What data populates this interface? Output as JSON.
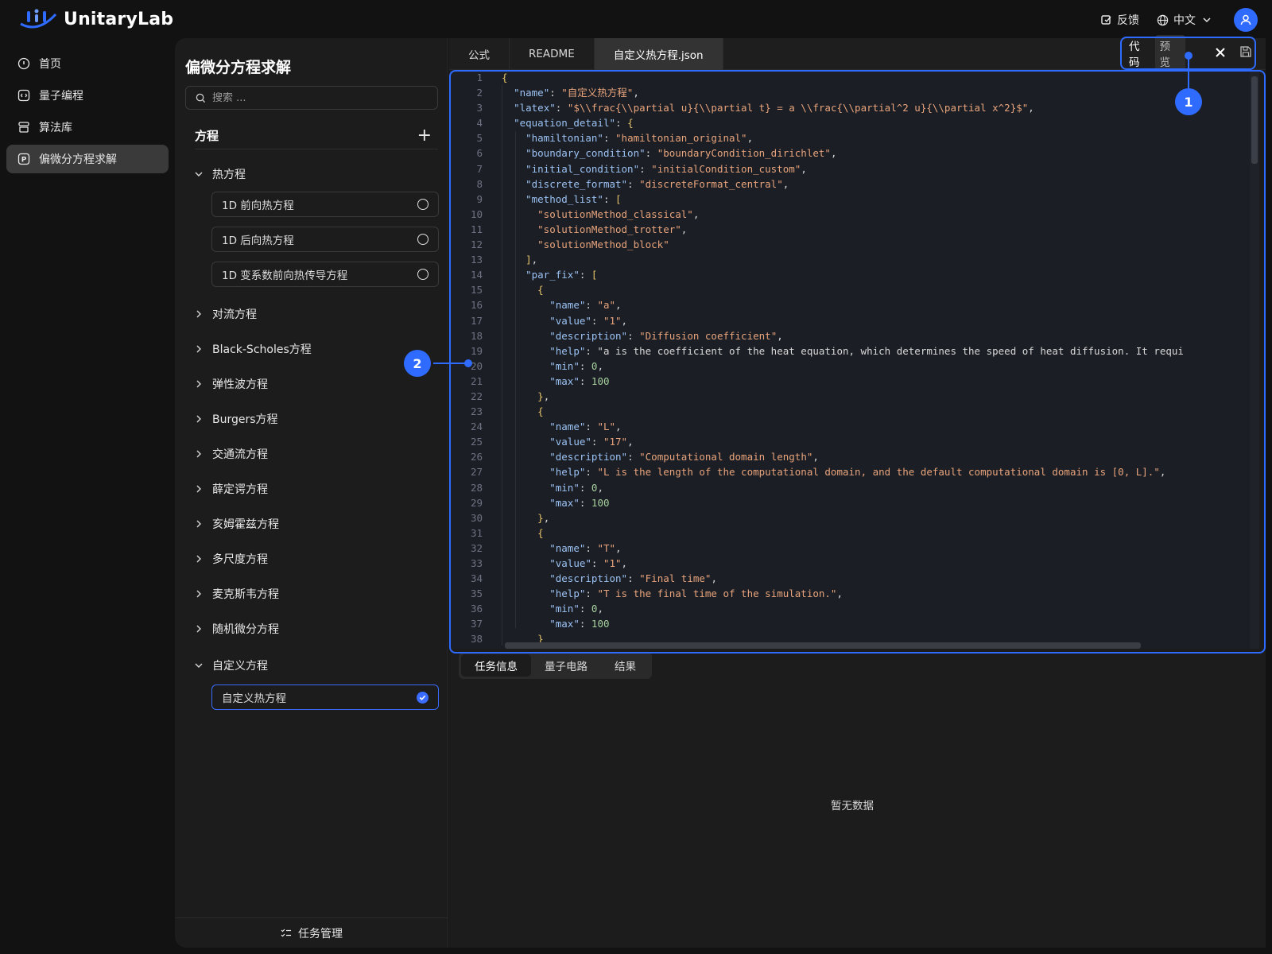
{
  "app": {
    "name": "UnitaryLab"
  },
  "topbar": {
    "feedback": "反馈",
    "language": "中文"
  },
  "nav": {
    "items": [
      {
        "label": "首页",
        "icon": "home-icon"
      },
      {
        "label": "量子编程",
        "icon": "code-icon"
      },
      {
        "label": "算法库",
        "icon": "library-icon"
      },
      {
        "label": "偏微分方程求解",
        "icon": "pde-icon"
      }
    ]
  },
  "panel": {
    "title": "偏微分方程求解",
    "search_placeholder": "搜索 ...",
    "section_label": "方程",
    "groups": [
      {
        "label": "热方程",
        "expanded": true,
        "items": [
          "1D 前向热方程",
          "1D 后向热方程",
          "1D 变系数前向热传导方程"
        ]
      },
      {
        "label": "对流方程"
      },
      {
        "label": "Black-Scholes方程"
      },
      {
        "label": "弹性波方程"
      },
      {
        "label": "Burgers方程"
      },
      {
        "label": "交通流方程"
      },
      {
        "label": "薛定谔方程"
      },
      {
        "label": "亥姆霍兹方程"
      },
      {
        "label": "多尺度方程"
      },
      {
        "label": "麦克斯韦方程"
      },
      {
        "label": "随机微分方程"
      },
      {
        "label": "自定义方程",
        "expanded": true,
        "items": [
          "自定义热方程"
        ],
        "selected": "自定义热方程"
      }
    ],
    "task_management": "任务管理"
  },
  "editor": {
    "tabs": [
      "公式",
      "README",
      "自定义热方程.json"
    ],
    "active_tab": "自定义热方程.json",
    "mode": {
      "code": "代码",
      "preview": "预览"
    },
    "lines": [
      "{",
      "  \"name\": \"自定义热方程\",",
      "  \"latex\": \"$\\\\frac{\\\\partial u}{\\\\partial t} = a \\\\frac{\\\\partial^2 u}{\\\\partial x^2}$\",",
      "  \"equation_detail\": {",
      "    \"hamiltonian\": \"hamiltonian_original\",",
      "    \"boundary_condition\": \"boundaryCondition_dirichlet\",",
      "    \"initial_condition\": \"initialCondition_custom\",",
      "    \"discrete_format\": \"discreteFormat_central\",",
      "    \"method_list\": [",
      "      \"solutionMethod_classical\",",
      "      \"solutionMethod_trotter\",",
      "      \"solutionMethod_block\"",
      "    ],",
      "    \"par_fix\": [",
      "      {",
      "        \"name\": \"a\",",
      "        \"value\": \"1\",",
      "        \"description\": \"Diffusion coefficient\",",
      "        \"help\": \"a is the coefficient of the heat equation, which determines the speed of heat diffusion. It requi",
      "        \"min\": 0,",
      "        \"max\": 100",
      "      },",
      "      {",
      "        \"name\": \"L\",",
      "        \"value\": \"17\",",
      "        \"description\": \"Computational domain length\",",
      "        \"help\": \"L is the length of the computational domain, and the default computational domain is [0, L].\",",
      "        \"min\": 0,",
      "        \"max\": 100",
      "      },",
      "      {",
      "        \"name\": \"T\",",
      "        \"value\": \"1\",",
      "        \"description\": \"Final time\",",
      "        \"help\": \"T is the final time of the simulation.\",",
      "        \"min\": 0,",
      "        \"max\": 100",
      "      }",
      "    ]"
    ]
  },
  "results": {
    "tabs": [
      "任务信息",
      "量子电路",
      "结果"
    ],
    "active": "任务信息",
    "empty_text": "暂无数据"
  },
  "annotations": [
    {
      "label": "1"
    },
    {
      "label": "2"
    }
  ],
  "colors": {
    "accent": "#2f6bff",
    "background": "#121212",
    "panel": "#1c1c1c",
    "code_bg": "#1b1e24"
  }
}
